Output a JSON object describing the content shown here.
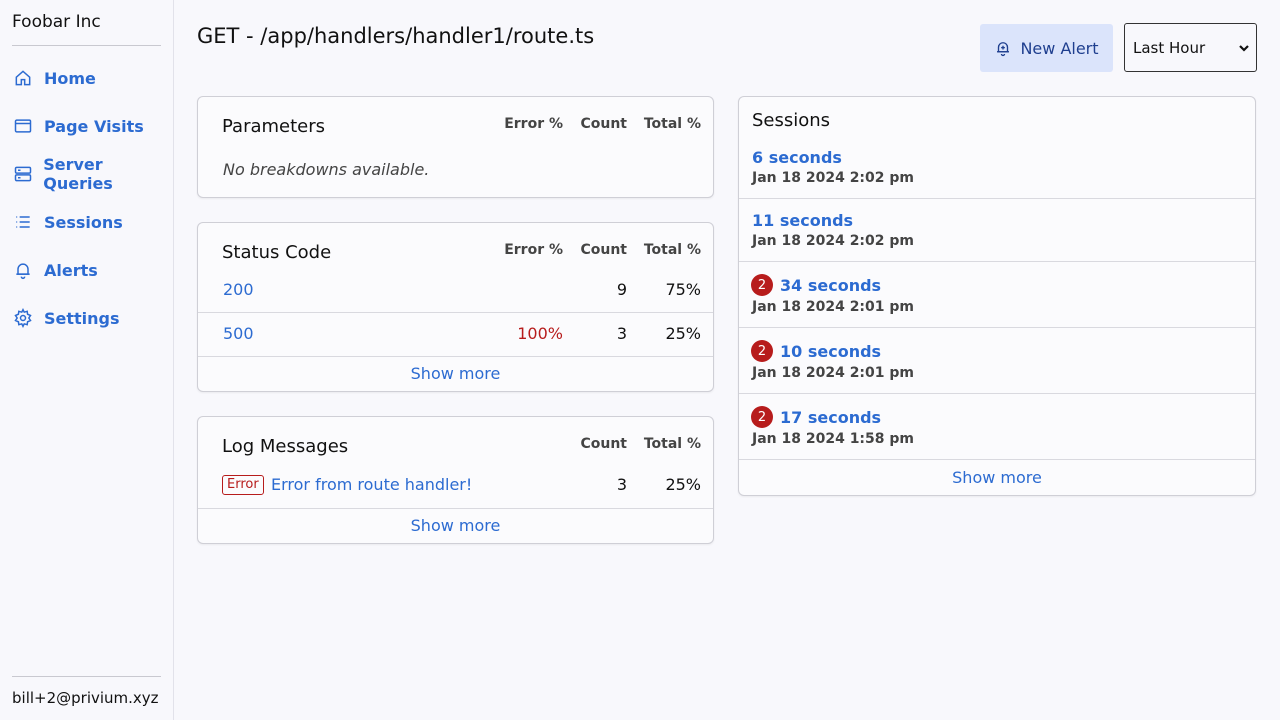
{
  "sidebar": {
    "org_name": "Foobar Inc",
    "items": [
      {
        "label": "Home",
        "icon": "home-icon"
      },
      {
        "label": "Page Visits",
        "icon": "browser-window-icon"
      },
      {
        "label": "Server Queries",
        "icon": "server-icon"
      },
      {
        "label": "Sessions",
        "icon": "list-icon"
      },
      {
        "label": "Alerts",
        "icon": "bell-icon"
      },
      {
        "label": "Settings",
        "icon": "gear-icon"
      }
    ],
    "user_email": "bill+2@privium.xyz"
  },
  "header": {
    "title": "GET - /app/handlers/handler1/route.ts",
    "new_alert_label": "New Alert",
    "time_range": "Last Hour"
  },
  "parameters": {
    "title": "Parameters",
    "col_error": "Error %",
    "col_count": "Count",
    "col_total": "Total %",
    "empty": "No breakdowns available."
  },
  "status_code": {
    "title": "Status Code",
    "col_error": "Error %",
    "col_count": "Count",
    "col_total": "Total %",
    "rows": [
      {
        "code": "200",
        "error": "",
        "count": "9",
        "total": "75%"
      },
      {
        "code": "500",
        "error": "100%",
        "count": "3",
        "total": "25%"
      }
    ],
    "show_more": "Show more"
  },
  "log_messages": {
    "title": "Log Messages",
    "col_count": "Count",
    "col_total": "Total %",
    "rows": [
      {
        "level": "Error",
        "message": "Error from route handler!",
        "count": "3",
        "total": "25%"
      }
    ],
    "show_more": "Show more"
  },
  "sessions": {
    "title": "Sessions",
    "items": [
      {
        "duration": "6 seconds",
        "date": "Jan 18 2024 2:02 pm",
        "errors": ""
      },
      {
        "duration": "11 seconds",
        "date": "Jan 18 2024 2:02 pm",
        "errors": ""
      },
      {
        "duration": "34 seconds",
        "date": "Jan 18 2024 2:01 pm",
        "errors": "2"
      },
      {
        "duration": "10 seconds",
        "date": "Jan 18 2024 2:01 pm",
        "errors": "2"
      },
      {
        "duration": "17 seconds",
        "date": "Jan 18 2024 1:58 pm",
        "errors": "2"
      }
    ],
    "show_more": "Show more"
  }
}
